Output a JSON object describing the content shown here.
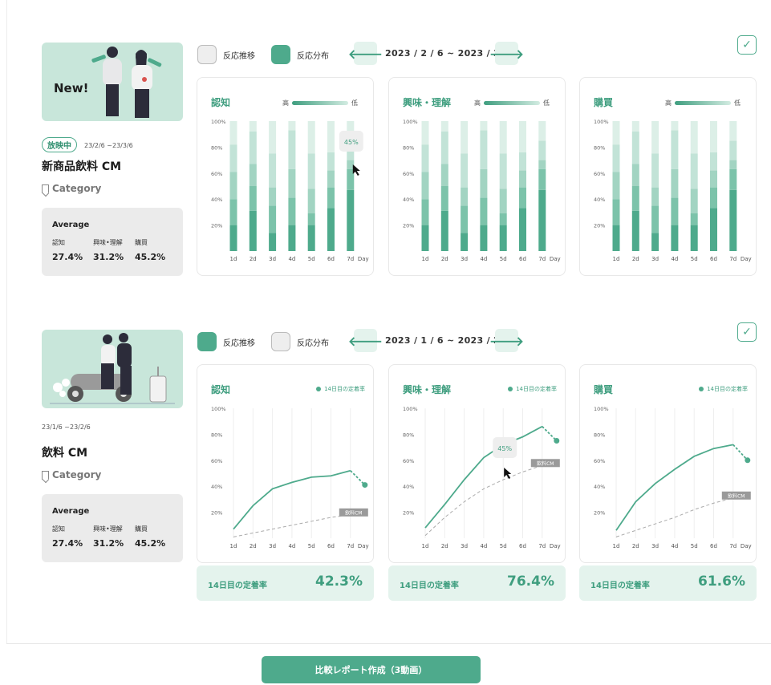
{
  "campaigns": [
    {
      "thumb_label": "New!",
      "status_badge": "放映中",
      "period": "23/2/6 ~23/3/6",
      "title": "新商品飲料 CM",
      "category": "Category",
      "average": {
        "title": "Average",
        "metrics": [
          {
            "label": "認知",
            "value": "27.4%"
          },
          {
            "label": "興味•理解",
            "value": "31.2%"
          },
          {
            "label": "購買",
            "value": "45.2%"
          }
        ]
      },
      "toggle": {
        "trend_label": "反応推移",
        "dist_label": "反応分布",
        "selected": "dist"
      },
      "date_range": "2023 / 2 / 6 ~ 2023 / 3 / 6",
      "prev_icon": "arrow-left-icon",
      "next_icon": "arrow-right-icon",
      "check_icon": "check-icon",
      "legend": {
        "high": "高",
        "low": "低"
      },
      "charts": [
        {
          "title": "認知",
          "tooltip": "45%",
          "tooltip_index": 6
        },
        {
          "title": "興味・理解"
        },
        {
          "title": "購買"
        }
      ]
    },
    {
      "period": "23/1/6 ~23/2/6",
      "title": "飲料 CM",
      "category": "Category",
      "average": {
        "title": "Average",
        "metrics": [
          {
            "label": "認知",
            "value": "27.4%"
          },
          {
            "label": "興味•理解",
            "value": "31.2%"
          },
          {
            "label": "購買",
            "value": "45.2%"
          }
        ]
      },
      "toggle": {
        "trend_label": "反応推移",
        "dist_label": "反応分布",
        "selected": "trend"
      },
      "date_range": "2023 / 1 / 6 ~ 2023 / 2 / 6",
      "prev_icon": "arrow-left-icon",
      "next_icon": "arrow-right-icon",
      "check_icon": "check-icon",
      "legend_dot": "14日目の定着率",
      "compare_label": "飲料CM",
      "rate_label": "14日目の定着率",
      "charts": [
        {
          "title": "認知",
          "rate": "42.3%"
        },
        {
          "title": "興味・理解",
          "rate": "76.4%",
          "tooltip": "45%",
          "tooltip_index": 4
        },
        {
          "title": "購買",
          "rate": "61.6%"
        }
      ]
    }
  ],
  "cta_label": "比較レポート作成（3動画）",
  "chart_data": [
    {
      "type": "bar",
      "title": "認知",
      "categories": [
        "1d",
        "2d",
        "3d",
        "4d",
        "5d",
        "6d",
        "7d"
      ],
      "x_unit": "Day",
      "y_ticks": [
        "20%",
        "40%",
        "60%",
        "80%",
        "100%"
      ],
      "ylim": [
        0,
        100
      ],
      "stacked": true,
      "legend": [
        "高",
        "低"
      ],
      "series": [
        {
          "values": [
            20,
            31,
            14,
            20,
            20,
            33,
            47
          ]
        },
        {
          "values": [
            20,
            19,
            21,
            21,
            9,
            16,
            16
          ]
        },
        {
          "values": [
            21,
            17,
            14,
            22,
            19,
            13,
            7
          ]
        },
        {
          "values": [
            21,
            25,
            26,
            30,
            27,
            14,
            15
          ]
        },
        {
          "values": [
            18,
            8,
            25,
            7,
            25,
            24,
            15
          ]
        }
      ]
    },
    {
      "type": "bar",
      "title": "興味・理解",
      "categories": [
        "1d",
        "2d",
        "3d",
        "4d",
        "5d",
        "6d",
        "7d"
      ],
      "x_unit": "Day",
      "y_ticks": [
        "20%",
        "40%",
        "60%",
        "80%",
        "100%"
      ],
      "ylim": [
        0,
        100
      ],
      "stacked": true,
      "legend": [
        "高",
        "低"
      ],
      "series": [
        {
          "values": [
            20,
            31,
            14,
            20,
            20,
            33,
            47
          ]
        },
        {
          "values": [
            20,
            19,
            21,
            21,
            9,
            16,
            16
          ]
        },
        {
          "values": [
            21,
            17,
            14,
            22,
            19,
            13,
            7
          ]
        },
        {
          "values": [
            21,
            25,
            26,
            30,
            27,
            14,
            15
          ]
        },
        {
          "values": [
            18,
            8,
            25,
            7,
            25,
            24,
            15
          ]
        }
      ]
    },
    {
      "type": "bar",
      "title": "購買",
      "categories": [
        "1d",
        "2d",
        "3d",
        "4d",
        "5d",
        "6d",
        "7d"
      ],
      "x_unit": "Day",
      "y_ticks": [
        "20%",
        "40%",
        "60%",
        "80%",
        "100%"
      ],
      "ylim": [
        0,
        100
      ],
      "stacked": true,
      "legend": [
        "高",
        "低"
      ],
      "series": [
        {
          "values": [
            20,
            31,
            14,
            20,
            20,
            33,
            47
          ]
        },
        {
          "values": [
            20,
            19,
            21,
            21,
            9,
            16,
            16
          ]
        },
        {
          "values": [
            21,
            17,
            14,
            22,
            19,
            13,
            7
          ]
        },
        {
          "values": [
            21,
            25,
            26,
            30,
            27,
            14,
            15
          ]
        },
        {
          "values": [
            18,
            8,
            25,
            7,
            25,
            24,
            15
          ]
        }
      ]
    },
    {
      "type": "line",
      "title": "認知",
      "categories": [
        "1d",
        "2d",
        "3d",
        "4d",
        "5d",
        "6d",
        "7d"
      ],
      "x_unit": "Day",
      "y_ticks": [
        "20%",
        "40%",
        "60%",
        "80%",
        "100%"
      ],
      "ylim": [
        0,
        100
      ],
      "series": [
        {
          "name": "14日目の定着率",
          "values": [
            7,
            25,
            38,
            43,
            47,
            48,
            52
          ],
          "projected": 41
        },
        {
          "name": "飲料CM",
          "values": [
            1,
            4,
            7,
            10,
            13,
            16,
            18
          ]
        }
      ]
    },
    {
      "type": "line",
      "title": "興味・理解",
      "categories": [
        "1d",
        "2d",
        "3d",
        "4d",
        "5d",
        "6d",
        "7d"
      ],
      "x_unit": "Day",
      "y_ticks": [
        "20%",
        "40%",
        "60%",
        "80%",
        "100%"
      ],
      "ylim": [
        0,
        100
      ],
      "series": [
        {
          "name": "14日目の定着率",
          "values": [
            8,
            26,
            45,
            62,
            72,
            78,
            86
          ],
          "projected": 75
        },
        {
          "name": "飲料CM",
          "values": [
            2,
            16,
            28,
            38,
            45,
            51,
            56
          ]
        }
      ]
    },
    {
      "type": "line",
      "title": "購買",
      "categories": [
        "1d",
        "2d",
        "3d",
        "4d",
        "5d",
        "6d",
        "7d"
      ],
      "x_unit": "Day",
      "y_ticks": [
        "20%",
        "40%",
        "60%",
        "80%",
        "100%"
      ],
      "ylim": [
        0,
        100
      ],
      "series": [
        {
          "name": "14日目の定着率",
          "values": [
            6,
            28,
            42,
            53,
            63,
            69,
            72
          ],
          "projected": 60
        },
        {
          "name": "飲料CM",
          "values": [
            1,
            6,
            11,
            16,
            22,
            27,
            31
          ]
        }
      ]
    }
  ],
  "colors": {
    "accent": "#4eaa8c",
    "accent_dark": "#3f9e7f",
    "accent_light": "#e4f3ed",
    "stack": [
      "#4eaa8c",
      "#7cc3aa",
      "#a2d4c2",
      "#c2e3d7",
      "#dcefe7"
    ]
  }
}
